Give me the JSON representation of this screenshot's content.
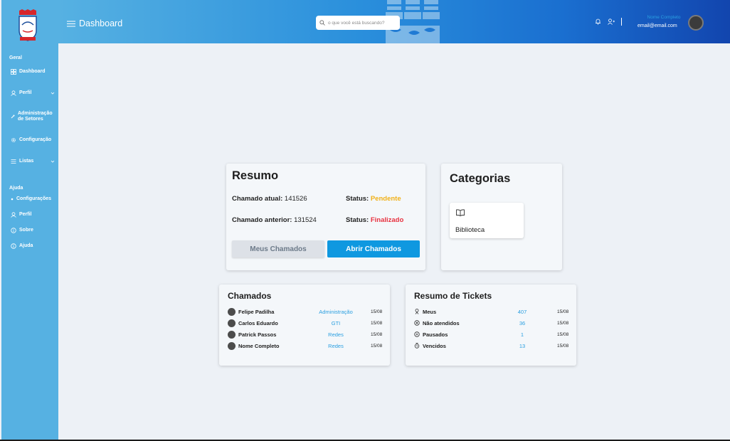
{
  "sidebar": {
    "section_geral": "Geral",
    "section_ajuda": "Ajuda",
    "items": [
      {
        "label": "Dashboard"
      },
      {
        "label": "Perfil"
      },
      {
        "label": "Administração de Setores"
      },
      {
        "label": "Configuração"
      },
      {
        "label": "Listas"
      }
    ],
    "help_items": [
      {
        "label": "Configurações"
      },
      {
        "label": "Perfil"
      },
      {
        "label": "Sobre"
      },
      {
        "label": "Ajuda"
      }
    ]
  },
  "header": {
    "title": "Dashboard",
    "search_placeholder": "o que você está buscando?",
    "user_name": "Nome Completo",
    "user_email": "email@email.com"
  },
  "resumo": {
    "title": "Resumo",
    "current_label": "Chamado atual:",
    "current_value": "141526",
    "status_label": "Status:",
    "current_status": "Pendente",
    "previous_label": "Chamado anterior:",
    "previous_value": "131524",
    "previous_status": "Finalizado",
    "btn_meus": "Meus Chamados",
    "btn_abrir": "Abrir Chamados"
  },
  "categorias": {
    "title": "Categorias",
    "items": [
      {
        "label": "Biblioteca",
        "icon": "book-icon"
      }
    ]
  },
  "chamados": {
    "title": "Chamados",
    "rows": [
      {
        "name": "Felipe Padilha",
        "dept": "Administração",
        "date": "15/08"
      },
      {
        "name": "Carlos Eduardo",
        "dept": "GTI",
        "date": "15/08"
      },
      {
        "name": "Patrick Passos",
        "dept": "Redes",
        "date": "15/08"
      },
      {
        "name": "Nome Completo",
        "dept": "Redes",
        "date": "15/08"
      }
    ]
  },
  "tickets": {
    "title": "Resumo de Tickets",
    "rows": [
      {
        "label": "Meus",
        "count": "407",
        "date": "15/08",
        "icon": "user-badge-icon"
      },
      {
        "label": "Não atendidos",
        "count": "36",
        "date": "15/08",
        "icon": "x-circle-icon"
      },
      {
        "label": "Pausados",
        "count": "1",
        "date": "15/08",
        "icon": "pause-circle-icon"
      },
      {
        "label": "Vencidos",
        "count": "13",
        "date": "15/08",
        "icon": "alarm-icon"
      }
    ]
  },
  "colors": {
    "sidebar": "#56b1e2",
    "accent": "#0f98e0",
    "pending": "#f1b119",
    "finished": "#e8313f"
  }
}
